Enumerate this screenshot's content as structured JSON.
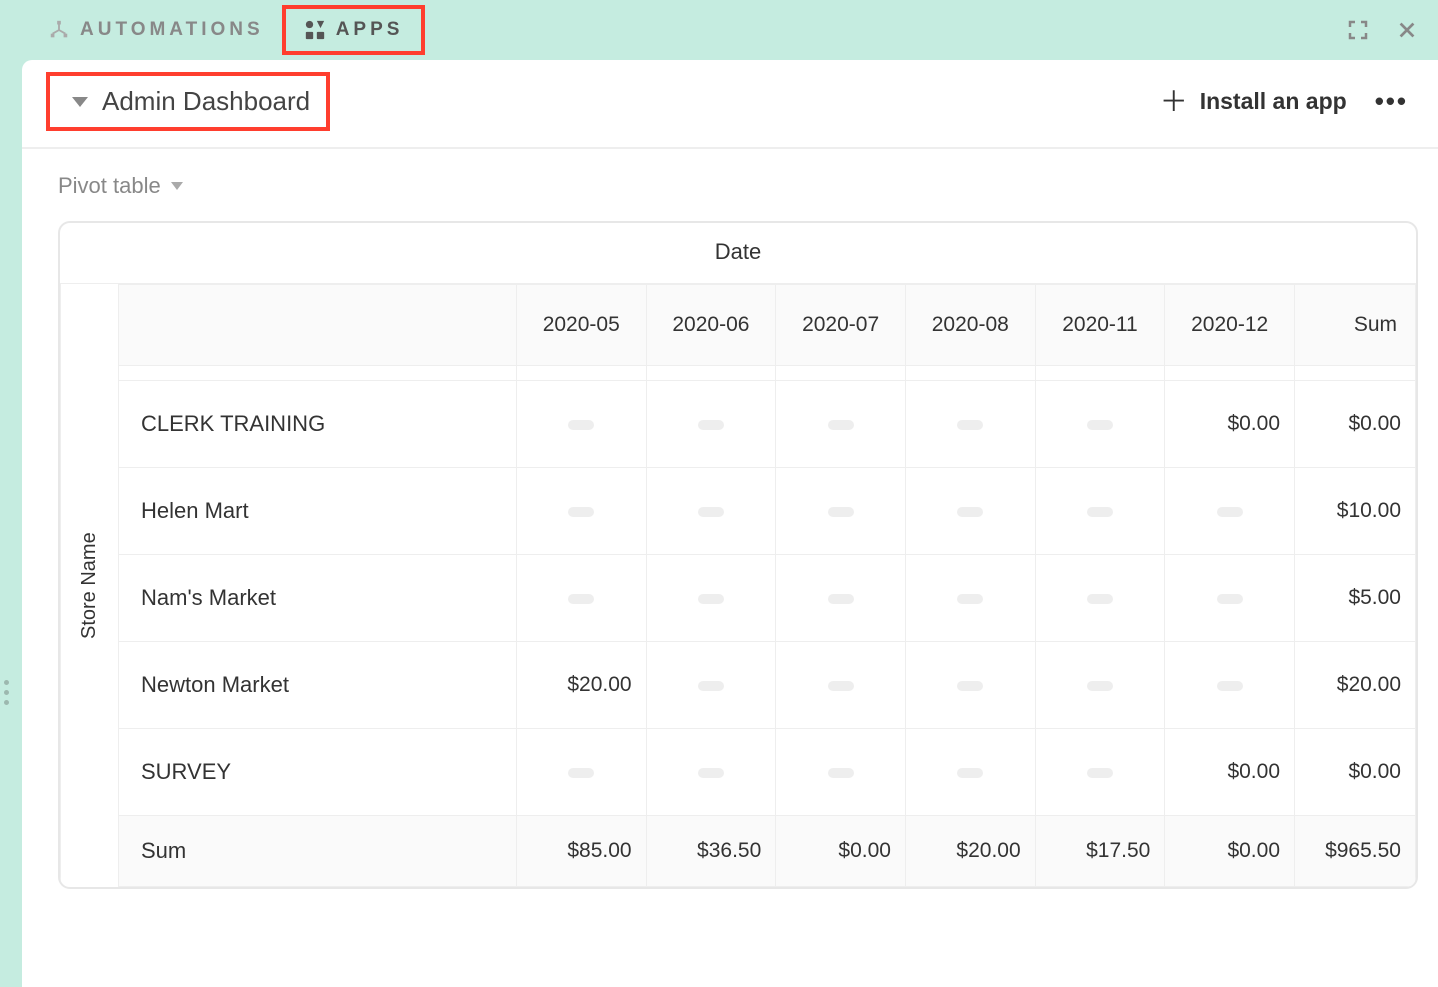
{
  "header": {
    "tabs": {
      "automations": "AUTOMATIONS",
      "apps": "APPS"
    }
  },
  "panel": {
    "dashboard_title": "Admin Dashboard",
    "install_label": "Install an app"
  },
  "pivot": {
    "title": "Pivot table",
    "col_axis_label": "Date",
    "row_axis_label": "Store Name",
    "columns": [
      "2020-05",
      "2020-06",
      "2020-07",
      "2020-08",
      "2020-11",
      "2020-12"
    ],
    "sum_header": "Sum",
    "rows": [
      {
        "label": "CLERK TRAINING",
        "values": [
          null,
          null,
          null,
          null,
          null,
          "$0.00"
        ],
        "sum": "$0.00"
      },
      {
        "label": "Helen Mart",
        "values": [
          null,
          null,
          null,
          null,
          null,
          null
        ],
        "sum": "$10.00"
      },
      {
        "label": "Nam's Market",
        "values": [
          null,
          null,
          null,
          null,
          null,
          null
        ],
        "sum": "$5.00"
      },
      {
        "label": "Newton Market",
        "values": [
          "$20.00",
          null,
          null,
          null,
          null,
          null
        ],
        "sum": "$20.00"
      },
      {
        "label": "SURVEY",
        "values": [
          null,
          null,
          null,
          null,
          null,
          "$0.00"
        ],
        "sum": "$0.00"
      }
    ],
    "totals": {
      "label": "Sum",
      "values": [
        "$85.00",
        "$36.50",
        "$0.00",
        "$20.00",
        "$17.50",
        "$0.00"
      ],
      "sum": "$965.50"
    }
  }
}
